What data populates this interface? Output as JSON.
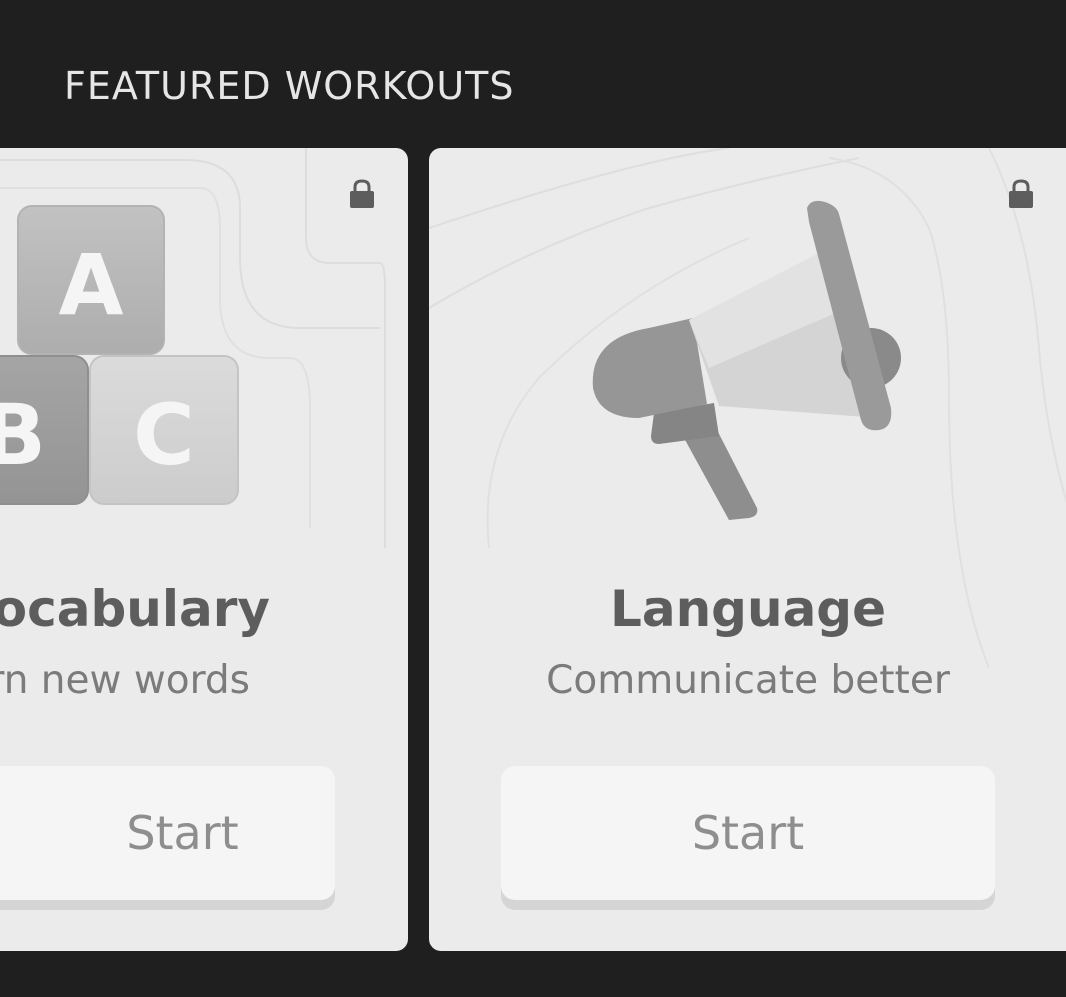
{
  "section": {
    "title": "FEATURED WORKOUTS"
  },
  "cards": [
    {
      "title": "ocabulary",
      "subtitle": "rn new words",
      "button_label": "Start",
      "locked": true,
      "lock_icon": "lock-icon",
      "illustration": "abc-blocks-icon",
      "letters": [
        "A",
        "B",
        "C"
      ]
    },
    {
      "title": "Language",
      "subtitle": "Communicate better",
      "button_label": "Start",
      "locked": true,
      "lock_icon": "lock-icon",
      "illustration": "megaphone-icon"
    }
  ],
  "colors": {
    "background": "#1f1f1f",
    "card": "#ebebeb",
    "button": "#f5f5f5",
    "title_text": "#5d5d5d",
    "subtitle_text": "#7b7b7b"
  }
}
